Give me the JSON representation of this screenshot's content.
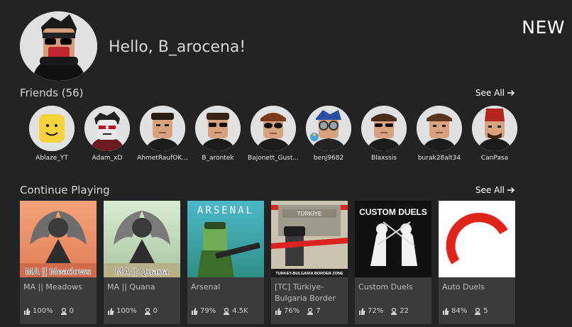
{
  "header": {
    "new_badge": "NEW"
  },
  "profile": {
    "greeting": "Hello, B_arocena!"
  },
  "friends": {
    "title": "Friends (56)",
    "see_all": "See All",
    "items": [
      {
        "name": "Ablaze_YT"
      },
      {
        "name": "Adam_xD"
      },
      {
        "name": "AhmetRaufOK..."
      },
      {
        "name": "B_arontek"
      },
      {
        "name": "Bajonett_Gust..."
      },
      {
        "name": "benj9682"
      },
      {
        "name": "Blaxssis"
      },
      {
        "name": "burak28alt34"
      },
      {
        "name": "CanPasa"
      }
    ]
  },
  "continue_playing": {
    "title": "Continue Playing",
    "see_all": "See All",
    "games": [
      {
        "title": "MA || Meadows",
        "thumb_text": "MA || Meadows",
        "rating": "100%",
        "players": "0"
      },
      {
        "title": "MA || Quana",
        "thumb_text": "MA || Quana",
        "rating": "100%",
        "players": "0"
      },
      {
        "title": "Arsenal",
        "thumb_text": "ARSENAL",
        "rating": "79%",
        "players": "4.5K"
      },
      {
        "title": "[TC] Türkiye-Bulgaria Border",
        "thumb_text": "TURKEY-BULGARIA BORDER ZONE",
        "thumb_sign": "TÜRKİYE",
        "rating": "76%",
        "players": "7"
      },
      {
        "title": "Custom Duels",
        "thumb_text": "CUSTOM DUELS",
        "rating": "72%",
        "players": "22"
      },
      {
        "title": "Auto Duels",
        "rating": "84%",
        "players": "5"
      }
    ]
  },
  "colors": {
    "background": "#222325",
    "card": "#393b3d",
    "avatar_bg": "#dfe1e2",
    "auto_duels_red": "#e2231a"
  }
}
